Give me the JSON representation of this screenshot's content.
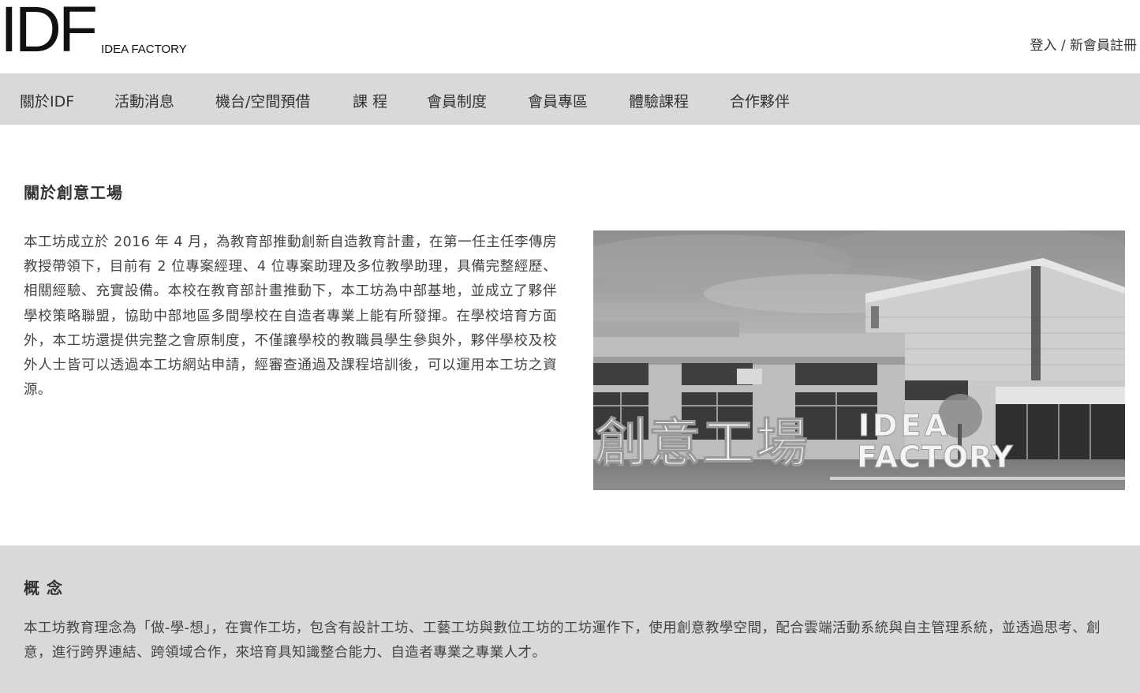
{
  "header": {
    "logo_main": "IDF",
    "logo_sub": "IDEA FACTORY",
    "login_label": "登入",
    "separator": " / ",
    "register_label": "新會員註冊"
  },
  "nav": {
    "items": [
      {
        "label": "關於IDF"
      },
      {
        "label": "活動消息"
      },
      {
        "label": "機台/空間預借"
      },
      {
        "label": "課 程"
      },
      {
        "label": "會員制度"
      },
      {
        "label": "會員專區"
      },
      {
        "label": "體驗課程"
      },
      {
        "label": "合作夥伴"
      }
    ]
  },
  "about": {
    "title": "關於創意工場",
    "body": "本工坊成立於 2016 年 4 月，為教育部推動創新自造教育計畫，在第一任主任李傳房教授帶領下，目前有 2 位專案經理、4 位專案助理及多位教學助理，具備完整經歷、相關經驗、充實設備。本校在教育部計畫推動下，本工坊為中部基地，並成立了夥伴學校策略聯盟，協助中部地區多間學校在自造者專業上能有所發揮。在學校培育方面外，本工坊還提供完整之會原制度，不僅讓學校的教職員學生參與外，夥伴學校及校外人士皆可以透過本工坊網站申請，經審查通過及課程培訓後，可以運用本工坊之資源。",
    "photo": {
      "sign_chinese": "創意工場",
      "sign_english_1": "IDEA",
      "sign_english_2": "FACTORY"
    }
  },
  "concept": {
    "title": "概 念",
    "body": "本工坊教育理念為「做-學-想」，在實作工坊，包含有設計工坊、工藝工坊與數位工坊的工坊運作下，使用創意教學空間，配合雲端活動系統與自主管理系統，並透過思考、創意，進行跨界連結、跨領域合作，來培育具知識整合能力、自造者專業之專業人才。"
  }
}
